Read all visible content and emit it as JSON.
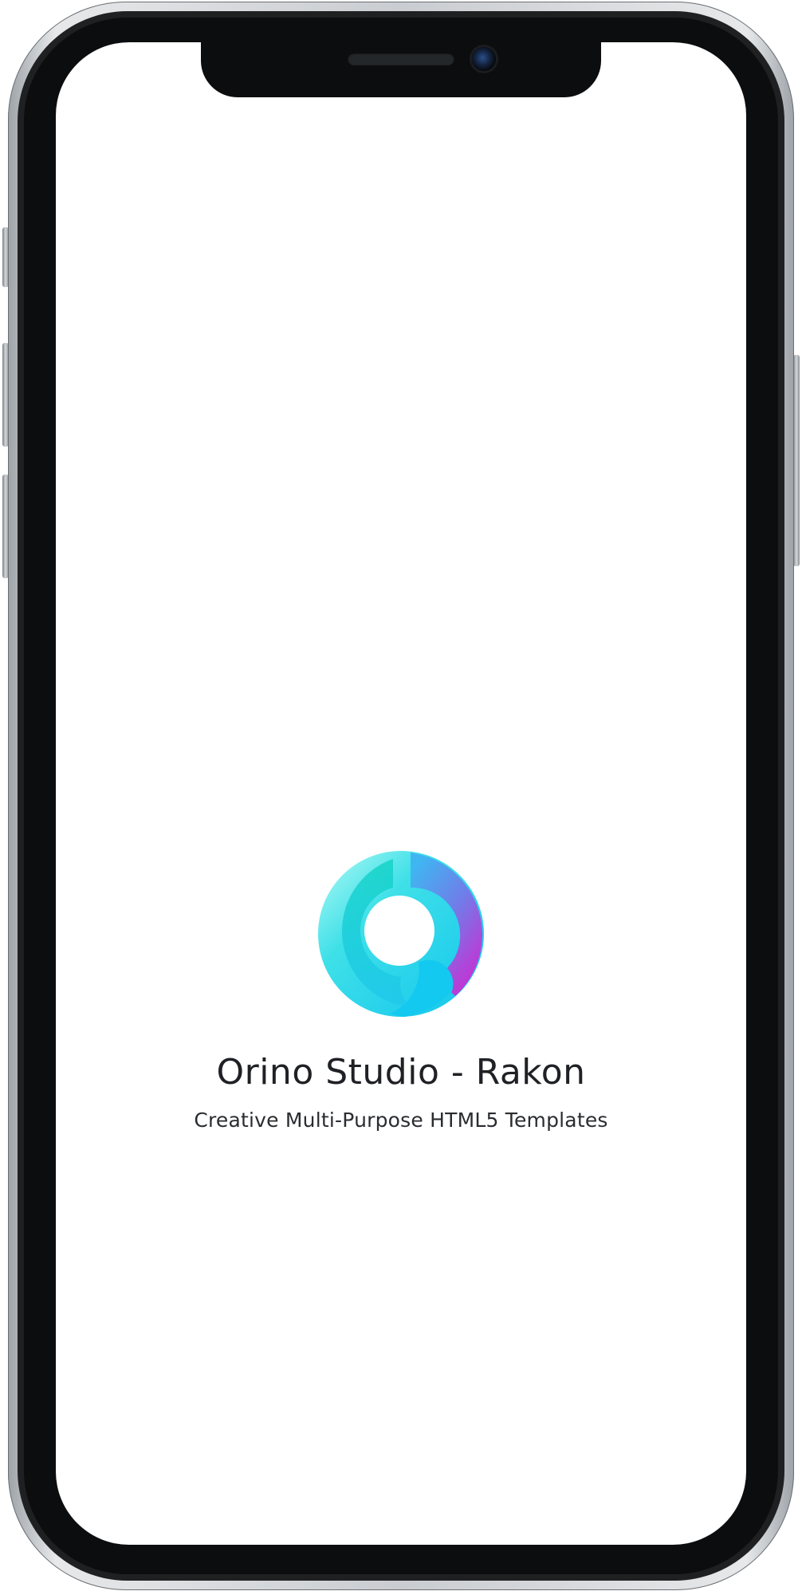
{
  "app": {
    "title": "Orino Studio - Rakon",
    "subtitle": "Creative Multi-Purpose HTML5 Templates"
  },
  "device": {
    "frame_color": "#0c0d0e",
    "screen_color": "#ffffff"
  },
  "logo": {
    "icon": "orino-logo-icon",
    "colors": [
      "#5ff3e6",
      "#1fd1e8",
      "#4aa8ef",
      "#7b6ee8",
      "#d22bd0"
    ]
  }
}
